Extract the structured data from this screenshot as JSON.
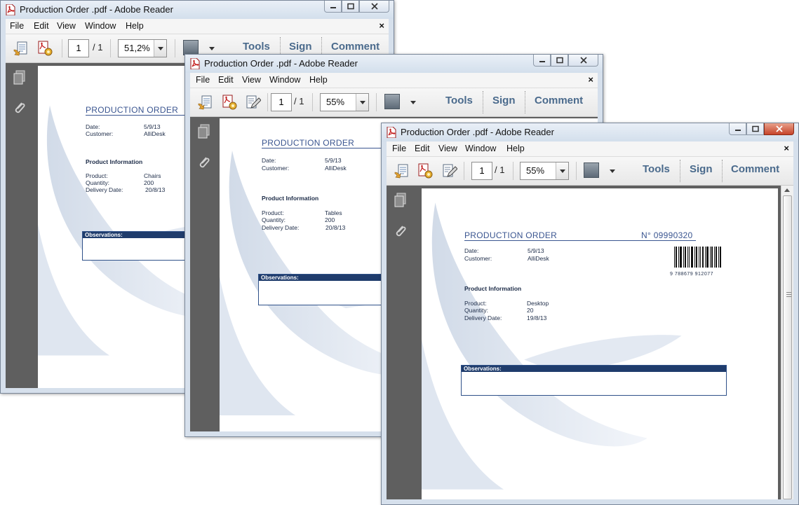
{
  "windows": [
    {
      "title": "Production Order .pdf - Adobe Reader",
      "menu": [
        "File",
        "Edit",
        "View",
        "Window",
        "Help"
      ],
      "menu_close": "×",
      "page_current": "1",
      "page_total": "/ 1",
      "zoom": "51,2%",
      "links": [
        "Tools",
        "Sign",
        "Comment"
      ],
      "doc": {
        "title": "PRODUCTION ORDER",
        "date_label": "Date:",
        "date_value": "5/9/13",
        "customer_label": "Customer:",
        "customer_value": "AlliDesk",
        "section": "Product Information",
        "product_label": "Product:",
        "product_value": "Chairs",
        "quantity_label": "Quantity:",
        "quantity_value": "200",
        "delivery_label": "Delivery Date:",
        "delivery_value": "20/8/13",
        "observations": "Observations:"
      }
    },
    {
      "title": "Production Order .pdf - Adobe Reader",
      "menu": [
        "File",
        "Edit",
        "View",
        "Window",
        "Help"
      ],
      "menu_close": "×",
      "page_current": "1",
      "page_total": "/ 1",
      "zoom": "55%",
      "links": [
        "Tools",
        "Sign",
        "Comment"
      ],
      "doc": {
        "title": "PRODUCTION ORDER",
        "date_label": "Date:",
        "date_value": "5/9/13",
        "customer_label": "Customer:",
        "customer_value": "AlliDesk",
        "section": "Product Information",
        "product_label": "Product:",
        "product_value": "Tables",
        "quantity_label": "Quantity:",
        "quantity_value": "200",
        "delivery_label": "Delivery Date:",
        "delivery_value": "20/8/13",
        "observations": "Observations:"
      }
    },
    {
      "title": "Production Order .pdf - Adobe Reader",
      "menu": [
        "File",
        "Edit",
        "View",
        "Window",
        "Help"
      ],
      "menu_close": "×",
      "page_current": "1",
      "page_total": "/ 1",
      "zoom": "55%",
      "links": [
        "Tools",
        "Sign",
        "Comment"
      ],
      "doc": {
        "title": "PRODUCTION ORDER",
        "order_number": "N° 09990320",
        "barcode_digits": "9 788679 912077",
        "date_label": "Date:",
        "date_value": "5/9/13",
        "customer_label": "Customer:",
        "customer_value": "AlliDesk",
        "section": "Product Information",
        "product_label": "Product:",
        "product_value": "Desktop",
        "quantity_label": "Quantity:",
        "quantity_value": "20",
        "delivery_label": "Delivery Date:",
        "delivery_value": "19/8/13",
        "observations": "Observations:"
      }
    }
  ],
  "colors": {
    "accent": "#3a5590",
    "observations_header": "#1f3c6c",
    "toolbar_links": "#4a6a8c",
    "close_active": "#c7442a"
  }
}
